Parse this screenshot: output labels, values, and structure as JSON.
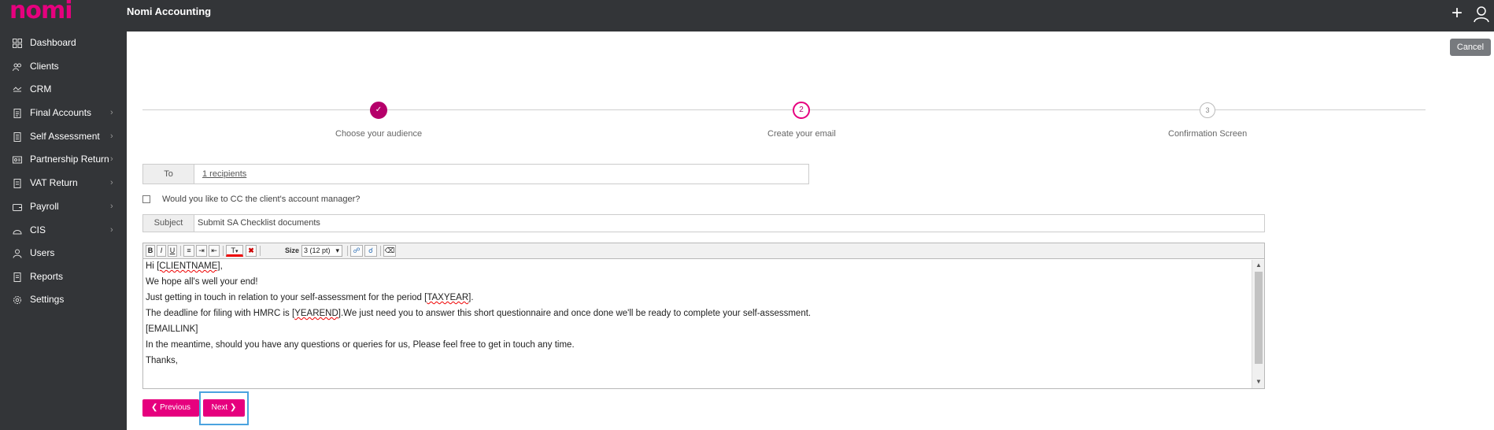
{
  "app": {
    "logo": "nomi",
    "title": "Nomi Accounting"
  },
  "colors": {
    "brand": "#e6007e",
    "step_done": "#b5006a",
    "sidebar_bg": "#333538",
    "focus_ring": "#4aa3df"
  },
  "header": {
    "add_icon": "plus-icon",
    "user_icon": "user-icon"
  },
  "sidebar": {
    "items": [
      {
        "label": "Dashboard",
        "icon": "dashboard-icon"
      },
      {
        "label": "Clients",
        "icon": "clients-icon"
      },
      {
        "label": "CRM",
        "icon": "crm-icon"
      },
      {
        "label": "Final Accounts",
        "icon": "final-accounts-icon"
      },
      {
        "label": "Self Assessment",
        "icon": "self-assessment-icon"
      },
      {
        "label": "Partnership Return",
        "icon": "partnership-icon"
      },
      {
        "label": "VAT Return",
        "icon": "vat-icon"
      },
      {
        "label": "Payroll",
        "icon": "payroll-icon"
      },
      {
        "label": "CIS",
        "icon": "cis-icon"
      },
      {
        "label": "Users",
        "icon": "users-icon"
      },
      {
        "label": "Reports",
        "icon": "reports-icon"
      },
      {
        "label": "Settings",
        "icon": "gear-icon"
      }
    ]
  },
  "actions": {
    "cancel": "Cancel",
    "previous": "Previous",
    "next": "Next"
  },
  "steps": [
    {
      "number": "✓",
      "label": "Choose your audience",
      "state": "done"
    },
    {
      "number": "2",
      "label": "Create your email",
      "state": "active"
    },
    {
      "number": "3",
      "label": "Confirmation Screen",
      "state": "pending"
    }
  ],
  "form": {
    "to_label": "To",
    "to_value": "1 recipients",
    "cc_label": "Would you like to CC the client's account manager?",
    "cc_checked": false,
    "subject_label": "Subject",
    "subject_value": "Submit SA Checklist documents"
  },
  "editor": {
    "toolbar": {
      "bold": "B",
      "italic": "I",
      "underline": "U",
      "text_color": "T",
      "size_label": "Size",
      "size_value": "3 (12 pt)"
    },
    "lines": {
      "l1a": "Hi ",
      "l1b": "[CLIENTNAME]",
      "l1c": ",",
      "l2": "We hope all's well your end!",
      "l3a": "Just getting in touch in relation to your self-assessment for the period [",
      "l3b": "TAXYEAR",
      "l3c": "].",
      "l4a": "The deadline for filing with HMRC is [",
      "l4b": "YEAREND",
      "l4c": "].We just need you to answer this short questionnaire and once done we'll be ready to complete your self-assessment.",
      "l5": "[EMAILLINK]",
      "l6": "In the meantime, should you have any questions or queries for us, Please feel free to get in touch any time.",
      "l7": "Thanks,"
    }
  }
}
